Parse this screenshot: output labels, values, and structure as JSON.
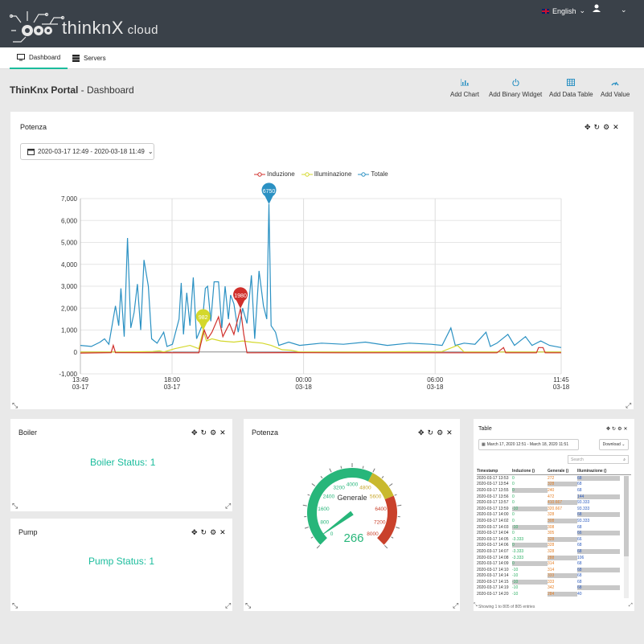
{
  "header": {
    "brand_main": "thinkn",
    "brand_x": "X",
    "brand_cloud": " cloud",
    "language": "English"
  },
  "tabs": [
    {
      "label": "Dashboard",
      "icon": "monitor-icon",
      "active": true
    },
    {
      "label": "Servers",
      "icon": "server-icon",
      "active": false
    }
  ],
  "page": {
    "title_bold": "ThinKnx Portal",
    "title_rest": " - Dashboard"
  },
  "actions": [
    {
      "label": "Add Chart",
      "icon": "chart-icon"
    },
    {
      "label": "Add Binary Widget",
      "icon": "power-icon"
    },
    {
      "label": "Add Data Table",
      "icon": "table-icon"
    },
    {
      "label": "Add Value",
      "icon": "gauge-icon"
    }
  ],
  "potenza_chart": {
    "title": "Potenza",
    "date_range": "2020-03-17 12:49 - 2020-03-18 11:49"
  },
  "chart_data": {
    "type": "line",
    "legend": [
      "Induzione",
      "Illuminazione",
      "Totale"
    ],
    "colors": {
      "Induzione": "#d0302c",
      "Illuminazione": "#d4d82c",
      "Totale": "#2b91c3"
    },
    "ylim": [
      -1000,
      7000
    ],
    "yticks": [
      "-1,000",
      "0",
      "1,000",
      "2,000",
      "3,000",
      "4,000",
      "5,000",
      "6,000",
      "7,000"
    ],
    "xticks": [
      {
        "time": "13:49",
        "date": "03-17",
        "h": 0
      },
      {
        "time": "18:00",
        "date": "03-17",
        "h": 4.18
      },
      {
        "time": "00:00",
        "date": "03-18",
        "h": 10.18
      },
      {
        "time": "06:00",
        "date": "03-18",
        "h": 16.18
      },
      {
        "time": "11:45",
        "date": "03-18",
        "h": 21.93
      }
    ],
    "xrange_hours": [
      0,
      21.93
    ],
    "markers": [
      {
        "series": "Totale",
        "label": "6750",
        "h": 8.6,
        "y": 6750
      },
      {
        "series": "Induzione",
        "label": "1980",
        "h": 7.3,
        "y": 1980
      },
      {
        "series": "Illuminazione",
        "label": "982",
        "h": 5.6,
        "y": 982
      }
    ],
    "series": [
      {
        "name": "Totale",
        "points": [
          [
            0,
            300
          ],
          [
            0.5,
            250
          ],
          [
            0.9,
            450
          ],
          [
            1.1,
            600
          ],
          [
            1.3,
            350
          ],
          [
            1.6,
            2100
          ],
          [
            1.75,
            1200
          ],
          [
            1.85,
            2900
          ],
          [
            2.0,
            700
          ],
          [
            2.15,
            5200
          ],
          [
            2.3,
            1100
          ],
          [
            2.45,
            1800
          ],
          [
            2.6,
            3100
          ],
          [
            2.75,
            1000
          ],
          [
            2.9,
            4200
          ],
          [
            3.1,
            3000
          ],
          [
            3.25,
            600
          ],
          [
            3.5,
            400
          ],
          [
            3.8,
            900
          ],
          [
            3.95,
            250
          ],
          [
            4.2,
            350
          ],
          [
            4.5,
            1500
          ],
          [
            4.6,
            3150
          ],
          [
            4.7,
            800
          ],
          [
            4.85,
            2700
          ],
          [
            5.0,
            1200
          ],
          [
            5.15,
            3400
          ],
          [
            5.3,
            600
          ],
          [
            5.55,
            1200
          ],
          [
            5.7,
            2900
          ],
          [
            5.8,
            3000
          ],
          [
            5.95,
            1400
          ],
          [
            6.1,
            3200
          ],
          [
            6.3,
            3200
          ],
          [
            6.45,
            1100
          ],
          [
            6.6,
            3000
          ],
          [
            6.75,
            1500
          ],
          [
            6.85,
            2600
          ],
          [
            7.0,
            2200
          ],
          [
            7.2,
            900
          ],
          [
            7.4,
            2000
          ],
          [
            7.6,
            1300
          ],
          [
            7.8,
            3500
          ],
          [
            7.95,
            600
          ],
          [
            8.15,
            3700
          ],
          [
            8.35,
            2100
          ],
          [
            8.5,
            1500
          ],
          [
            8.6,
            6750
          ],
          [
            8.7,
            1200
          ],
          [
            8.9,
            900
          ],
          [
            9.05,
            300
          ],
          [
            9.5,
            450
          ],
          [
            10,
            300
          ],
          [
            11,
            400
          ],
          [
            12,
            350
          ],
          [
            13,
            450
          ],
          [
            14,
            300
          ],
          [
            15,
            400
          ],
          [
            16,
            350
          ],
          [
            16.5,
            300
          ],
          [
            16.9,
            1100
          ],
          [
            17.1,
            300
          ],
          [
            17.5,
            400
          ],
          [
            18,
            350
          ],
          [
            18.5,
            900
          ],
          [
            18.7,
            250
          ],
          [
            19,
            400
          ],
          [
            19.5,
            800
          ],
          [
            19.8,
            300
          ],
          [
            20.3,
            700
          ],
          [
            20.6,
            300
          ],
          [
            21,
            500
          ],
          [
            21.4,
            300
          ],
          [
            21.93,
            200
          ]
        ]
      },
      {
        "name": "Illuminazione",
        "points": [
          [
            0,
            0
          ],
          [
            2,
            0
          ],
          [
            3.3,
            20
          ],
          [
            3.6,
            50
          ],
          [
            3.8,
            0
          ],
          [
            4.3,
            150
          ],
          [
            5.0,
            300
          ],
          [
            5.4,
            150
          ],
          [
            5.6,
            982
          ],
          [
            5.75,
            500
          ],
          [
            6.0,
            600
          ],
          [
            6.4,
            500
          ],
          [
            7.0,
            450
          ],
          [
            7.4,
            500
          ],
          [
            7.8,
            450
          ],
          [
            8.3,
            400
          ],
          [
            8.7,
            300
          ],
          [
            9.2,
            100
          ],
          [
            9.6,
            80
          ],
          [
            10,
            0
          ],
          [
            12,
            0
          ],
          [
            16.5,
            20
          ],
          [
            17.2,
            300
          ],
          [
            17.5,
            0
          ],
          [
            21.93,
            0
          ]
        ]
      },
      {
        "name": "Induzione",
        "points": [
          [
            0,
            -50
          ],
          [
            1.4,
            -30
          ],
          [
            1.5,
            300
          ],
          [
            1.6,
            -30
          ],
          [
            5.4,
            -40
          ],
          [
            5.5,
            400
          ],
          [
            5.65,
            1000
          ],
          [
            5.8,
            600
          ],
          [
            6.0,
            900
          ],
          [
            6.3,
            1600
          ],
          [
            6.5,
            700
          ],
          [
            6.8,
            1300
          ],
          [
            7.0,
            800
          ],
          [
            7.3,
            1980
          ],
          [
            7.45,
            800
          ],
          [
            7.6,
            -40
          ],
          [
            9.5,
            -30
          ],
          [
            12,
            -40
          ],
          [
            17.0,
            -40
          ],
          [
            19,
            -40
          ],
          [
            19.3,
            200
          ],
          [
            19.4,
            -40
          ],
          [
            20.0,
            -40
          ],
          [
            20.8,
            -40
          ],
          [
            20.9,
            200
          ],
          [
            21.1,
            200
          ],
          [
            21.2,
            -40
          ],
          [
            21.93,
            -40
          ]
        ]
      }
    ]
  },
  "boiler": {
    "title": "Boiler",
    "status": "Boiler Status: 1"
  },
  "pump": {
    "title": "Pump",
    "status": "Pump Status: 1"
  },
  "gauge": {
    "title": "Potenza",
    "label": "Generale",
    "value": 266,
    "min": 0,
    "max": 8000,
    "ticks": [
      "0",
      "800",
      "1600",
      "2400",
      "3200",
      "4000",
      "4800",
      "5600",
      "6400",
      "7200",
      "8000"
    ]
  },
  "table": {
    "title": "Table",
    "date_range": "March 17, 2020 12:51 - March 18, 2020 11:51",
    "download_label": "Download",
    "search_placeholder": "Search",
    "headers": [
      "Timestamp",
      "Induzione ()",
      "Generale ()",
      "Illuminazione ()"
    ],
    "footer": "Showing 1 to 805 of 805 entries",
    "rows": [
      [
        "2020-03-17 13:53",
        "0",
        "272",
        "68"
      ],
      [
        "2020-03-17 13:54",
        "0",
        "328",
        "68"
      ],
      [
        "2020-03-17 13:55",
        "0",
        "240",
        "68"
      ],
      [
        "2020-03-17 13:56",
        "0",
        "472",
        "144"
      ],
      [
        "2020-03-17 13:57",
        "0",
        "410.667",
        "93.333"
      ],
      [
        "2020-03-17 13:59",
        "-10",
        "320.667",
        "93.333"
      ],
      [
        "2020-03-17 14:00",
        "0",
        "328",
        "68"
      ],
      [
        "2020-03-17 14:02",
        "0",
        "308",
        "93.333"
      ],
      [
        "2020-03-17 14:03",
        "-10",
        "308",
        "68"
      ],
      [
        "2020-03-17 14:04",
        "0",
        "305",
        "66"
      ],
      [
        "2020-03-17 14:05",
        "-3.333",
        "328",
        "66"
      ],
      [
        "2020-03-17 14:06",
        "0",
        "328",
        "68"
      ],
      [
        "2020-03-17 14:07",
        "-3.333",
        "328",
        "68"
      ],
      [
        "2020-03-17 14:08",
        "-3.333",
        "288",
        "106"
      ],
      [
        "2020-03-17 14:09",
        "0",
        "314",
        "68"
      ],
      [
        "2020-03-17 14:10",
        "-10",
        "314",
        "68"
      ],
      [
        "2020-03-17 14:14",
        "-10",
        "333",
        "68"
      ],
      [
        "2020-03-17 14:15",
        "-10",
        "333",
        "68"
      ],
      [
        "2020-03-17 14:19",
        "-10",
        "342",
        "68"
      ],
      [
        "2020-03-17 14:20",
        "-10",
        "284",
        "40"
      ]
    ]
  }
}
